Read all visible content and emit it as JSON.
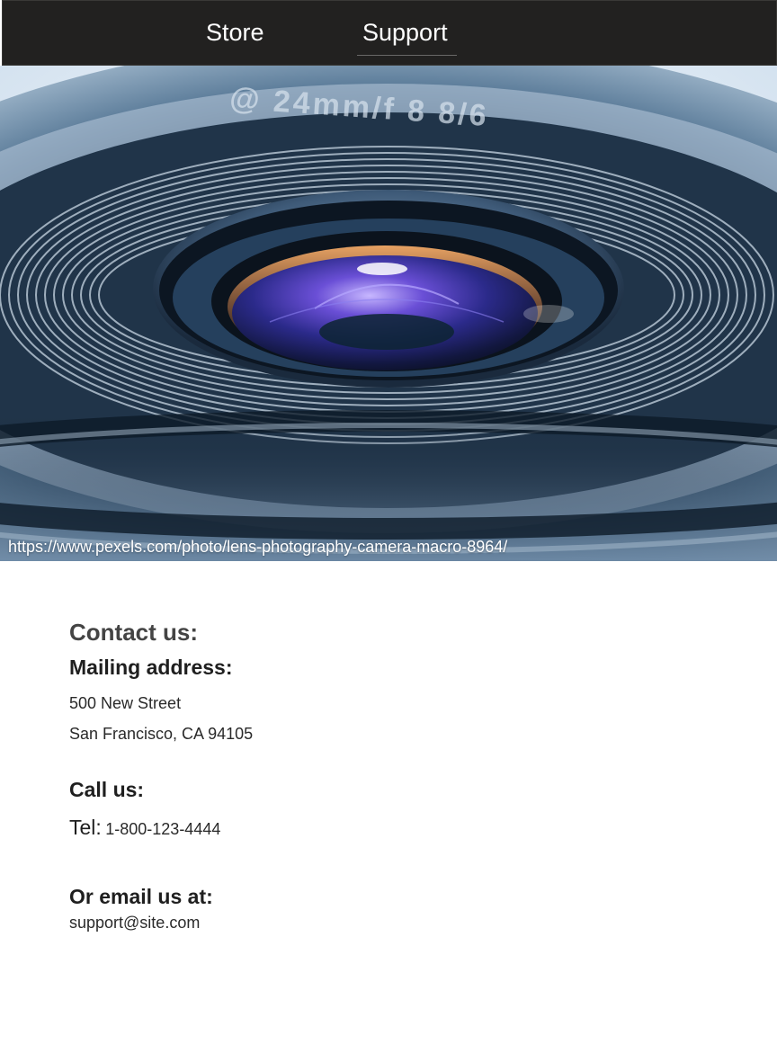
{
  "nav": {
    "items": [
      {
        "label": "Store"
      },
      {
        "label": "Support"
      }
    ],
    "active": "Support"
  },
  "hero": {
    "caption": "https://www.pexels.com/photo/lens-photography-camera-macro-8964/",
    "image": "camera lens macro photo",
    "lens_marking": "@ 24mm/f 8 8/6"
  },
  "contact": {
    "heading": "Contact us:",
    "mailing_heading": "Mailing address:",
    "address_line1": "500 New Street",
    "address_line2": "San Francisco, CA 94105",
    "call_heading": "Call us:",
    "tel_label": "Tel:",
    "tel_number": "1-800-123-4444",
    "email_heading": "Or email us at:",
    "email": "support@site.com"
  },
  "colors": {
    "navbar_bg": "#222120",
    "nav_text": "#ffffff",
    "page_bg": "#ffffff",
    "body_text": "#222222",
    "heading_muted": "#444444"
  }
}
